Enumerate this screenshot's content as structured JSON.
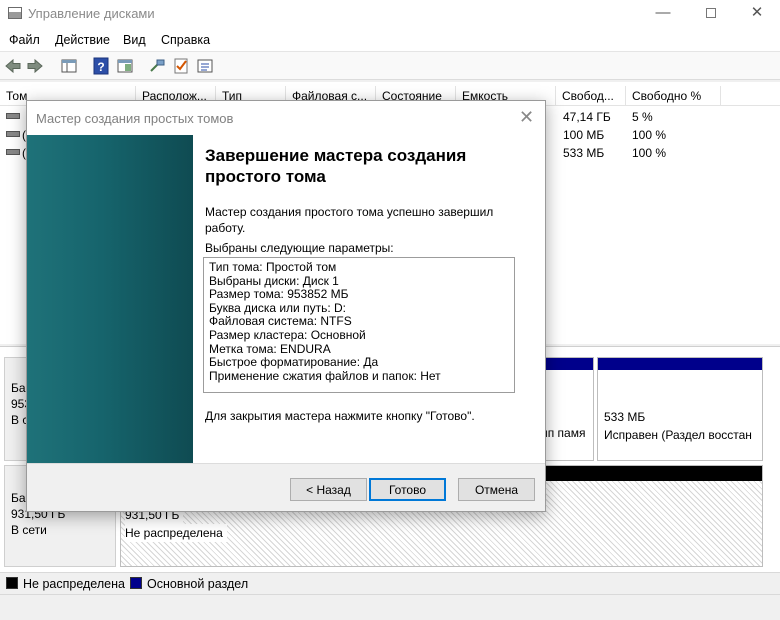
{
  "window": {
    "title": "Управление дисками"
  },
  "menu": [
    "Файл",
    "Действие",
    "Вид",
    "Справка"
  ],
  "volume_list": {
    "columns": [
      "Том",
      "Располож...",
      "Тип",
      "Файловая с...",
      "Состояние",
      "Емкость",
      "Свобод...",
      "Свободно %"
    ],
    "rows": [
      {
        "name": "",
        "free": "47,14 ГБ",
        "free_pct": "5 %"
      },
      {
        "name": "(",
        "free": "100 МБ",
        "free_pct": "100 %"
      },
      {
        "name": "(",
        "free": "533 МБ",
        "free_pct": "100 %"
      }
    ]
  },
  "disk_map": {
    "disk0": {
      "label_lines": [
        "Ба",
        "953",
        "В с"
      ],
      "partial_status": "ип памя",
      "recovery_size": "533 МБ",
      "recovery_status": "Исправен (Раздел восстан"
    },
    "disk1": {
      "label_lines": [
        "Ба",
        "931,50 ГБ",
        "В сети"
      ],
      "unalloc_size": "931,50 ГБ",
      "unalloc_label": "Не распределена"
    }
  },
  "legend": {
    "unallocated": "Не распределена",
    "primary": "Основной раздел"
  },
  "colors": {
    "unallocated": "#000000",
    "primary": "#00008b",
    "banner": "#16646c"
  },
  "wizard": {
    "title": "Мастер создания простых томов",
    "heading": "Завершение мастера создания простого тома",
    "success_text": "Мастер создания простого тома успешно завершил работу.",
    "params_label": "Выбраны следующие параметры:",
    "params": [
      "Тип тома: Простой том",
      "Выбраны диски: Диск 1",
      "Размер тома: 953852 МБ",
      "Буква диска или путь: D:",
      "Файловая система: NTFS",
      "Размер кластера: Основной",
      "Метка тома: ENDURA",
      "Быстрое форматирование: Да",
      "Применение сжатия файлов и папок: Нет"
    ],
    "close_hint": "Для закрытия мастера нажмите кнопку \"Готово\".",
    "buttons": {
      "back": "< Назад",
      "finish": "Готово",
      "cancel": "Отмена"
    }
  }
}
